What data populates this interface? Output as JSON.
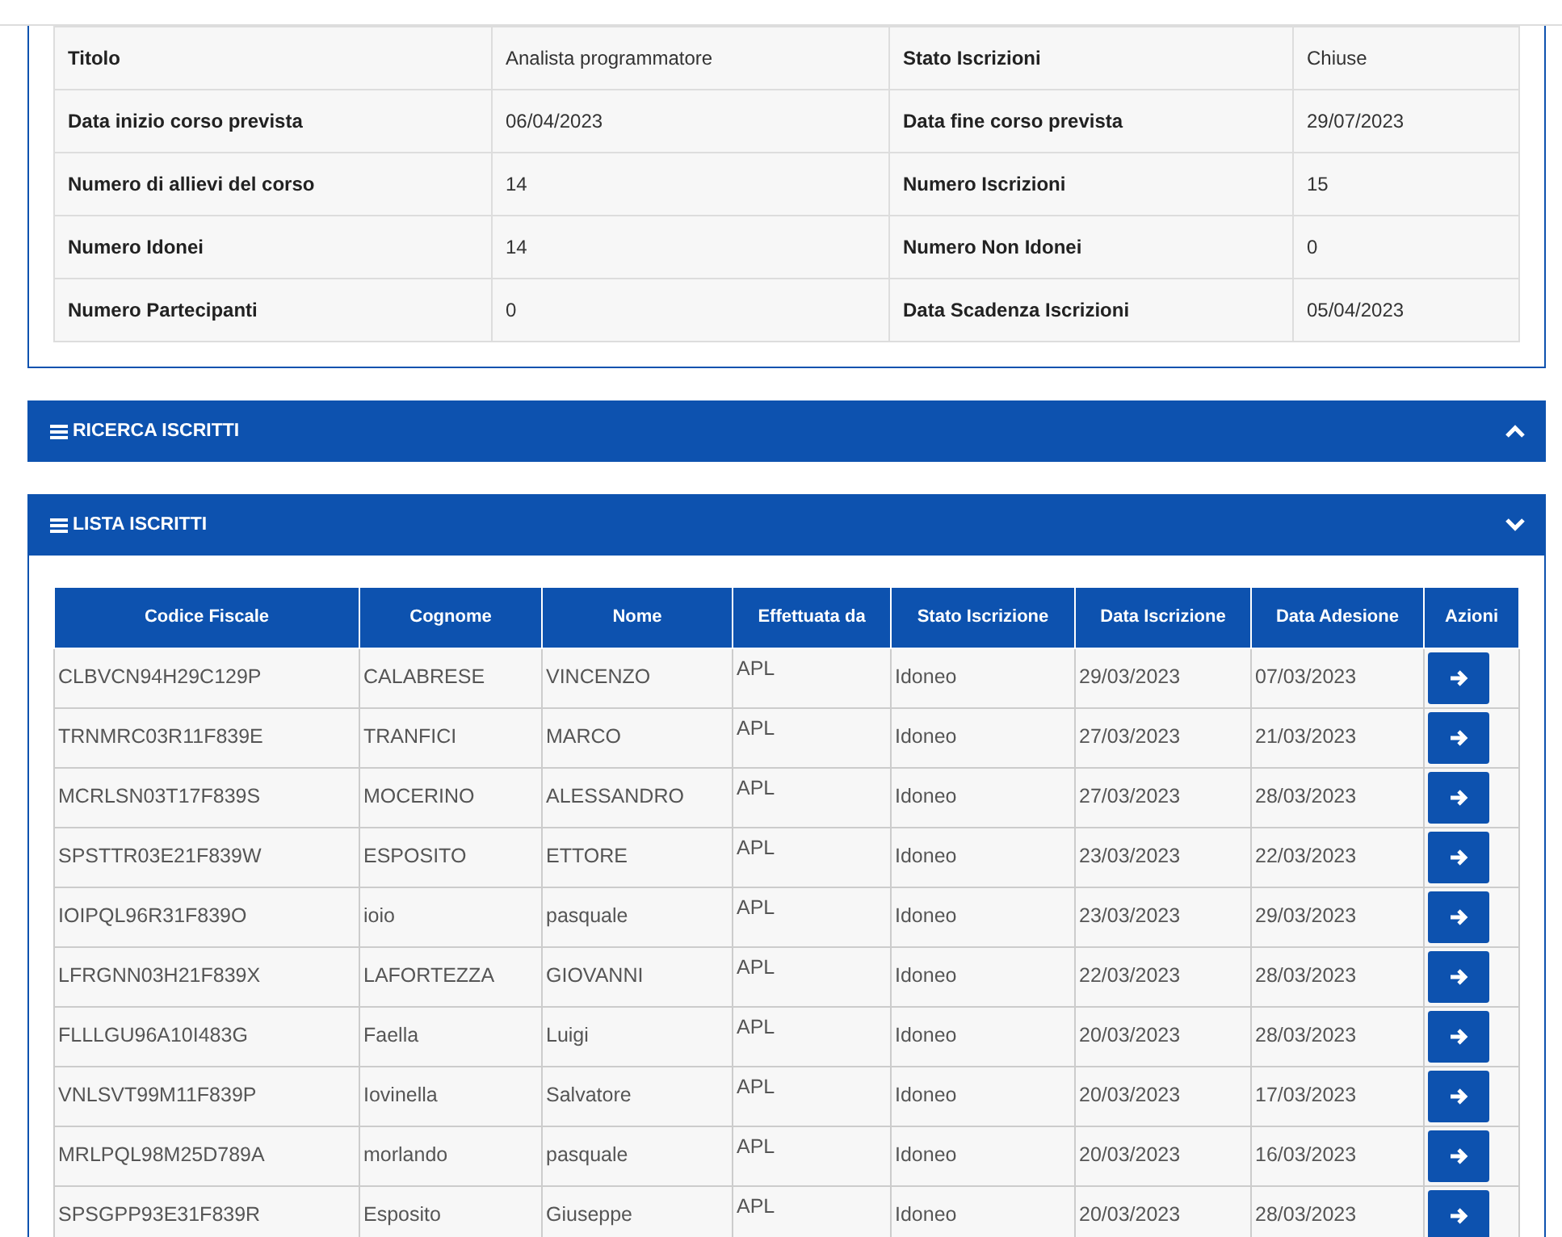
{
  "course_details": [
    {
      "label": "Titolo",
      "value": "Analista programmatore",
      "label_2": "Stato Iscrizioni",
      "value_2": "Chiuse"
    },
    {
      "label": "Data inizio corso prevista",
      "value": "06/04/2023",
      "label_2": "Data fine corso prevista",
      "value_2": "29/07/2023"
    },
    {
      "label": "Numero di allievi del corso",
      "value": "14",
      "label_2": "Numero Iscrizioni",
      "value_2": "15"
    },
    {
      "label": "Numero Idonei",
      "value": "14",
      "label_2": "Numero Non Idonei",
      "value_2": "0"
    },
    {
      "label": "Numero Partecipanti",
      "value": "0",
      "label_2": "Data Scadenza Iscrizioni",
      "value_2": "05/04/2023"
    }
  ],
  "panels": [
    {
      "title": "RICERCA ISCRITTI",
      "expanded": false
    },
    {
      "title": "LISTA ISCRITTI",
      "expanded": true
    }
  ],
  "table": {
    "columns": [
      "Codice Fiscale",
      "Cognome",
      "Nome",
      "Effettuata da",
      "Stato Iscrizione",
      "Data Iscrizione",
      "Data Adesione",
      "Azioni"
    ],
    "rows": [
      [
        "CLBVCN94H29C129P",
        "CALABRESE",
        "VINCENZO",
        "APL",
        "Idoneo",
        "29/03/2023",
        "07/03/2023"
      ],
      [
        "TRNMRC03R11F839E",
        "TRANFICI",
        "MARCO",
        "APL",
        "Idoneo",
        "27/03/2023",
        "21/03/2023"
      ],
      [
        "MCRLSN03T17F839S",
        "MOCERINO",
        "ALESSANDRO",
        "APL",
        "Idoneo",
        "27/03/2023",
        "28/03/2023"
      ],
      [
        "SPSTTR03E21F839W",
        "ESPOSITO",
        "ETTORE",
        "APL",
        "Idoneo",
        "23/03/2023",
        "22/03/2023"
      ],
      [
        "IOIPQL96R31F839O",
        "ioio",
        "pasquale",
        "APL",
        "Idoneo",
        "23/03/2023",
        "29/03/2023"
      ],
      [
        "LFRGNN03H21F839X",
        "LAFORTEZZA",
        "GIOVANNI",
        "APL",
        "Idoneo",
        "22/03/2023",
        "28/03/2023"
      ],
      [
        "FLLLGU96A10I483G",
        "Faella",
        "Luigi",
        "APL",
        "Idoneo",
        "20/03/2023",
        "28/03/2023"
      ],
      [
        "VNLSVT99M11F839P",
        "Iovinella",
        "Salvatore",
        "APL",
        "Idoneo",
        "20/03/2023",
        "17/03/2023"
      ],
      [
        "MRLPQL98M25D789A",
        "morlando",
        "pasquale",
        "APL",
        "Idoneo",
        "20/03/2023",
        "16/03/2023"
      ],
      [
        "SPSGPP93E31F839R",
        "Esposito",
        "Giuseppe",
        "APL",
        "Idoneo",
        "20/03/2023",
        "28/03/2023"
      ]
    ]
  }
}
